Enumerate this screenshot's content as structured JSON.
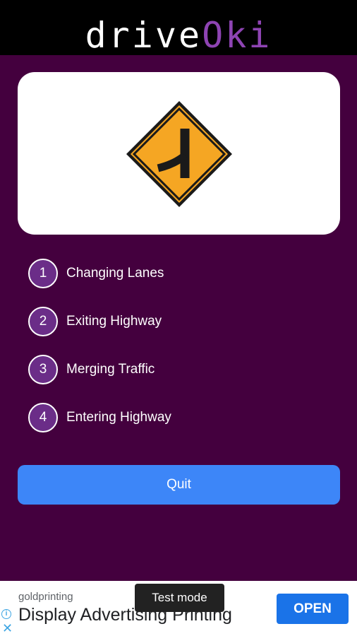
{
  "app": {
    "logo_part1": "drive",
    "logo_part2": "Oki"
  },
  "question": {
    "sign_icon": "merging-traffic-sign-icon",
    "sign_color": "#f5a623"
  },
  "answers": [
    {
      "number": "1",
      "label": "Changing Lanes"
    },
    {
      "number": "2",
      "label": "Exiting Highway"
    },
    {
      "number": "3",
      "label": "Merging Traffic"
    },
    {
      "number": "4",
      "label": "Entering Highway"
    }
  ],
  "actions": {
    "quit_label": "Quit"
  },
  "ad": {
    "source": "goldprinting",
    "headline": "Display Advertising Printing",
    "open_label": "OPEN",
    "test_mode_label": "Test mode"
  },
  "colors": {
    "background": "#44003e",
    "accent": "#8e44b3",
    "quit_button": "#3d86f8"
  }
}
